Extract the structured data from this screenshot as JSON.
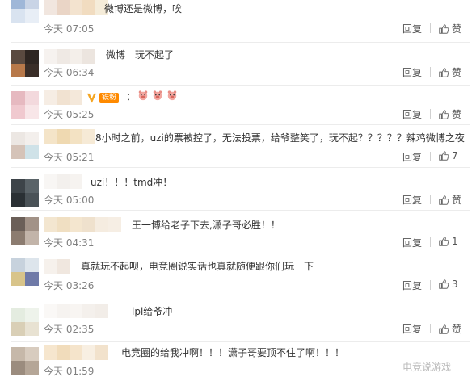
{
  "comments": [
    {
      "text": "微博还是微博，唉",
      "time": "今天 07:05",
      "reply": "回复",
      "like": "赞"
    },
    {
      "text": "微博　玩不起了",
      "time": "今天 06:34",
      "reply": "回复",
      "like": "赞"
    },
    {
      "text": "：",
      "badge": "铁粉",
      "emoji": [
        "pig-emoji",
        "pig-emoji",
        "pig-emoji"
      ],
      "time": "今天 05:25",
      "reply": "回复",
      "like": "赞"
    },
    {
      "text": "8小时之前，uzi的票被控了，无法投票，给爷整笑了，玩不起？？？？？辣鸡微博之夜",
      "time": "今天 05:21",
      "reply": "回复",
      "like": "7"
    },
    {
      "text": "uzi！！！tmd冲！",
      "time": "今天 05:00",
      "reply": "回复",
      "like": "赞"
    },
    {
      "text": "王一博给老子下去,潇子哥必胜！！",
      "time": "今天 04:31",
      "reply": "回复",
      "like": "1"
    },
    {
      "text": "真就玩不起呗，电竞圈说实话也真就随便跟你们玩一下",
      "time": "今天 03:26",
      "reply": "回复",
      "like": "3"
    },
    {
      "text": "lpl给爷冲",
      "time": "今天 02:35",
      "reply": "回复",
      "like": "赞"
    },
    {
      "text": "电竞圈的给我冲啊！！！潇子哥要顶不住了啊！！！",
      "time": "今天 01:59",
      "reply": "回复",
      "like": "赞"
    }
  ],
  "watermark": "电竞说游戏",
  "colors": {
    "time": "#808080",
    "badge": "#ff8a00",
    "vip": "#f5a623"
  }
}
